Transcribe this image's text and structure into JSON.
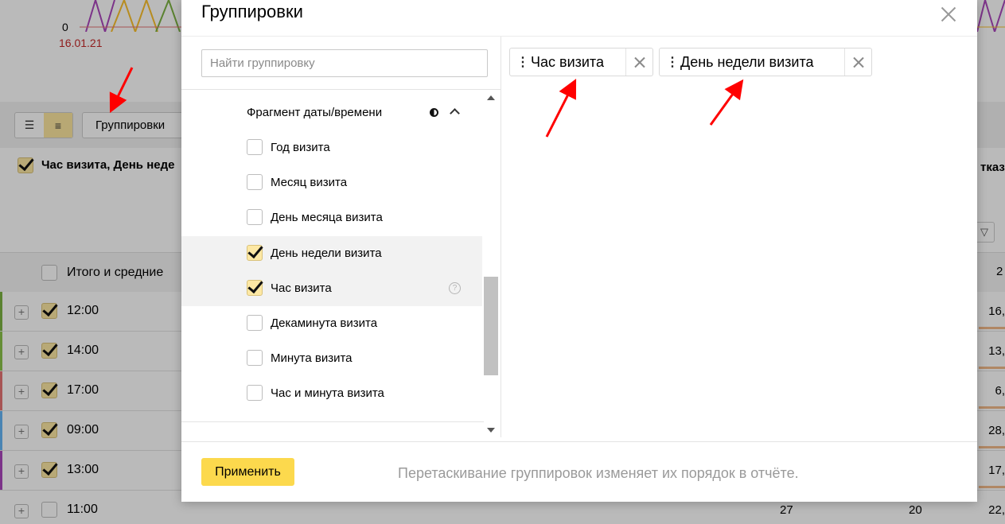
{
  "background": {
    "chart": {
      "axis_zero": "0",
      "axis_date": "16.01.21"
    },
    "toolbar": {
      "groupings_button": "Группировки"
    },
    "selected_groupings": "Час визита, День неде",
    "right_header_fragment": "тказы",
    "total_label": "Итого и средние",
    "header_value_fragment": "2",
    "rows": [
      {
        "time": "12:00",
        "value": "16,",
        "checked": true,
        "stripe": "#7cb342"
      },
      {
        "time": "14:00",
        "value": "13,",
        "checked": true,
        "stripe": "#8bc34a"
      },
      {
        "time": "17:00",
        "value": "6,",
        "checked": true,
        "stripe": "#e57373"
      },
      {
        "time": "09:00",
        "value": "28,",
        "checked": true,
        "stripe": "#64b5f6"
      },
      {
        "time": "13:00",
        "value": "17,",
        "checked": true,
        "stripe": "#ab47bc"
      },
      {
        "time": "11:00",
        "value": "22,",
        "checked": false,
        "stripe": "#ffffff",
        "extra1": "27",
        "extra2": "20"
      }
    ]
  },
  "modal": {
    "title": "Группировки",
    "search_placeholder": "Найти группировку",
    "section_title": "Фрагмент даты/времени",
    "items": [
      {
        "label": "Год визита",
        "checked": false
      },
      {
        "label": "Месяц визита",
        "checked": false
      },
      {
        "label": "День месяца визита",
        "checked": false
      },
      {
        "label": "День недели визита",
        "checked": true
      },
      {
        "label": "Час визита",
        "checked": true,
        "help": "?"
      },
      {
        "label": "Декаминута визита",
        "checked": false
      },
      {
        "label": "Минута визита",
        "checked": false
      },
      {
        "label": "Час и минута визита",
        "checked": false
      }
    ],
    "selected_chips": [
      "Час визита",
      "День недели визита"
    ],
    "apply_label": "Применить",
    "hint": "Перетаскивание группировок изменяет их порядок в отчёте."
  },
  "colors": {
    "accent_yellow": "#fcd94d",
    "checkbox_checked": "#fde8a4",
    "annotation_arrow": "#ff0000",
    "date_label": "#c62828"
  }
}
